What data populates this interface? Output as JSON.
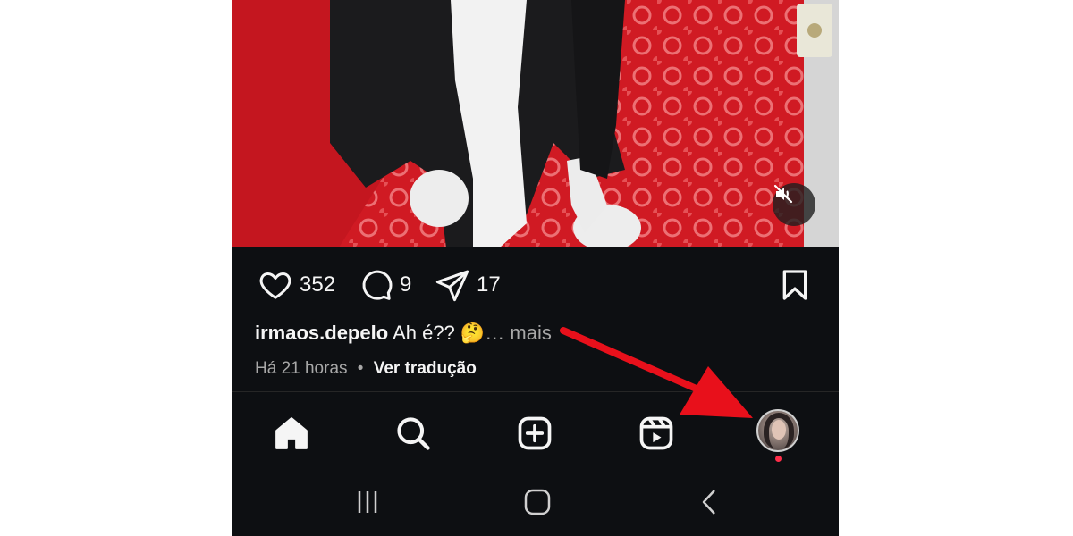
{
  "post": {
    "likes": "352",
    "comments": "9",
    "shares": "17",
    "username": "irmaos.depelo",
    "caption_text": "Ah é?? 🤔",
    "more": "… mais",
    "time_ago": "Há 21 horas",
    "separator": "•",
    "translate": "Ver tradução"
  },
  "icons": {
    "mute": "muted-speaker-icon",
    "like": "heart-icon",
    "comment": "comment-bubble-icon",
    "share": "paper-plane-icon",
    "save": "bookmark-icon",
    "home": "home-icon",
    "search": "search-icon",
    "create": "plus-square-icon",
    "reels": "reels-icon",
    "profile": "profile-avatar",
    "recents": "recent-apps-icon",
    "home_sys": "system-home-icon",
    "back": "back-icon"
  },
  "colors": {
    "background": "#0d0f12",
    "text": "#f5f5f5",
    "muted_text": "#a8a8a8",
    "notification": "#ff2d49",
    "annotation_arrow": "#e8101b"
  }
}
